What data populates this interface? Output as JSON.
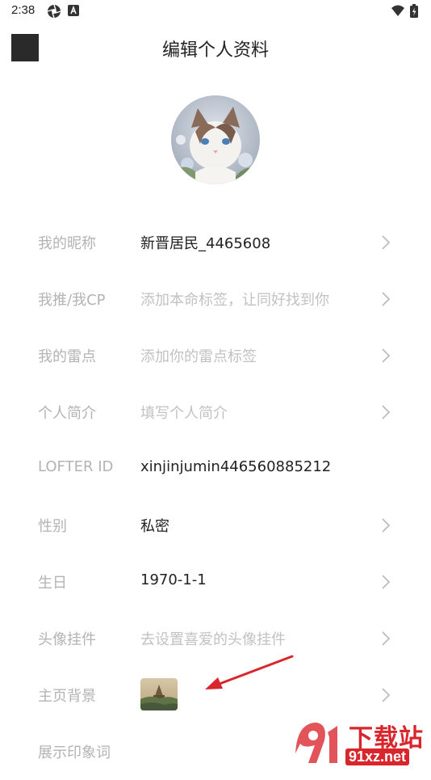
{
  "status_bar": {
    "time": "2:38"
  },
  "header": {
    "title": "编辑个人资料"
  },
  "rows": [
    {
      "label": "我的昵称",
      "value": "新晋居民_4465608",
      "placeholder": false,
      "chevron": true
    },
    {
      "label": "我推/我CP",
      "value": "添加本命标签，让同好找到你",
      "placeholder": true,
      "chevron": true
    },
    {
      "label": "我的雷点",
      "value": "添加你的雷点标签",
      "placeholder": true,
      "chevron": true
    },
    {
      "label": "个人简介",
      "value": "填写个人简介",
      "placeholder": true,
      "chevron": true
    },
    {
      "label": "LOFTER ID",
      "value": "xinjinjumin446560885212",
      "placeholder": false,
      "chevron": false
    },
    {
      "label": "性别",
      "value": "私密",
      "placeholder": false,
      "chevron": true
    },
    {
      "label": "生日",
      "value": "1970-1-1",
      "placeholder": false,
      "chevron": true
    },
    {
      "label": "头像挂件",
      "value": "去设置喜爱的头像挂件",
      "placeholder": true,
      "chevron": true
    },
    {
      "label": "主页背景",
      "value": "",
      "placeholder": false,
      "chevron": true
    },
    {
      "label": "展示印象词",
      "value": "",
      "placeholder": false,
      "chevron": false
    }
  ],
  "watermark": {
    "brand": "下载站",
    "domain": "91xz.net"
  },
  "colors": {
    "label": "#b3b3b3",
    "value": "#222222",
    "placeholder": "#c2c2c2",
    "accent_red": "#d9262c"
  }
}
